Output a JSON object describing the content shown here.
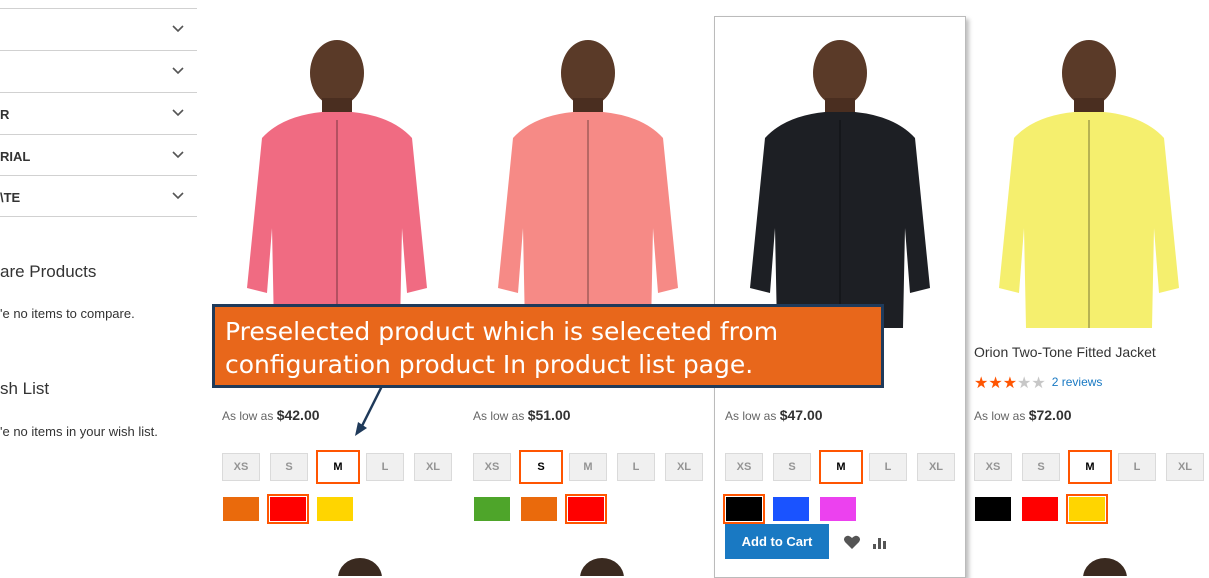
{
  "sidebar": {
    "filters": [
      {
        "label": ""
      },
      {
        "label": ""
      },
      {
        "label": "R"
      },
      {
        "label": "RIAL"
      },
      {
        "label": "\\TE"
      }
    ],
    "compare": {
      "title": "are Products",
      "text": "'e no items to compare."
    },
    "wishlist": {
      "title": "sh List",
      "text": "'e no items in your wish list."
    }
  },
  "products": [
    {
      "name": "",
      "price_prefix": "As low as",
      "price": "$42.00",
      "sizes": [
        "XS",
        "S",
        "M",
        "L",
        "XL"
      ],
      "selected_size": "M",
      "colors": [
        "#ea6a0c",
        "#ff0000",
        "#ffd500"
      ],
      "selected_color": 1,
      "jacket_color": "#f06b82"
    },
    {
      "name": "",
      "price_prefix": "As low as",
      "price": "$51.00",
      "sizes": [
        "XS",
        "S",
        "M",
        "L",
        "XL"
      ],
      "selected_size": "S",
      "colors": [
        "#4ea52a",
        "#ea6a0c",
        "#ff0000"
      ],
      "selected_color": 2,
      "jacket_color": "#f68a86"
    },
    {
      "name": "",
      "price_prefix": "As low as",
      "price": "$47.00",
      "sizes": [
        "XS",
        "S",
        "M",
        "L",
        "XL"
      ],
      "selected_size": "M",
      "colors": [
        "#000000",
        "#1a53ff",
        "#ec41ef"
      ],
      "selected_color": 0,
      "jacket_color": "#1d1f24",
      "add_to_cart": "Add to Cart"
    },
    {
      "name": "Orion Two-Tone Fitted Jacket",
      "rating_stars": 2.5,
      "reviews": "2 reviews",
      "price_prefix": "As low as",
      "price": "$72.00",
      "sizes": [
        "XS",
        "S",
        "M",
        "L",
        "XL"
      ],
      "selected_size": "M",
      "colors": [
        "#000000",
        "#ff0000",
        "#ffd500"
      ],
      "selected_color": 2,
      "jacket_color": "#f5ef6e"
    }
  ],
  "callout": {
    "line1": "Preselected product which is seleceted from",
    "line2": "configuration product In product list page."
  },
  "colors": {
    "accent": "#ff5501",
    "primary": "#1979c3",
    "callout_bg": "#e8671b",
    "callout_border": "#1f3a5a"
  }
}
